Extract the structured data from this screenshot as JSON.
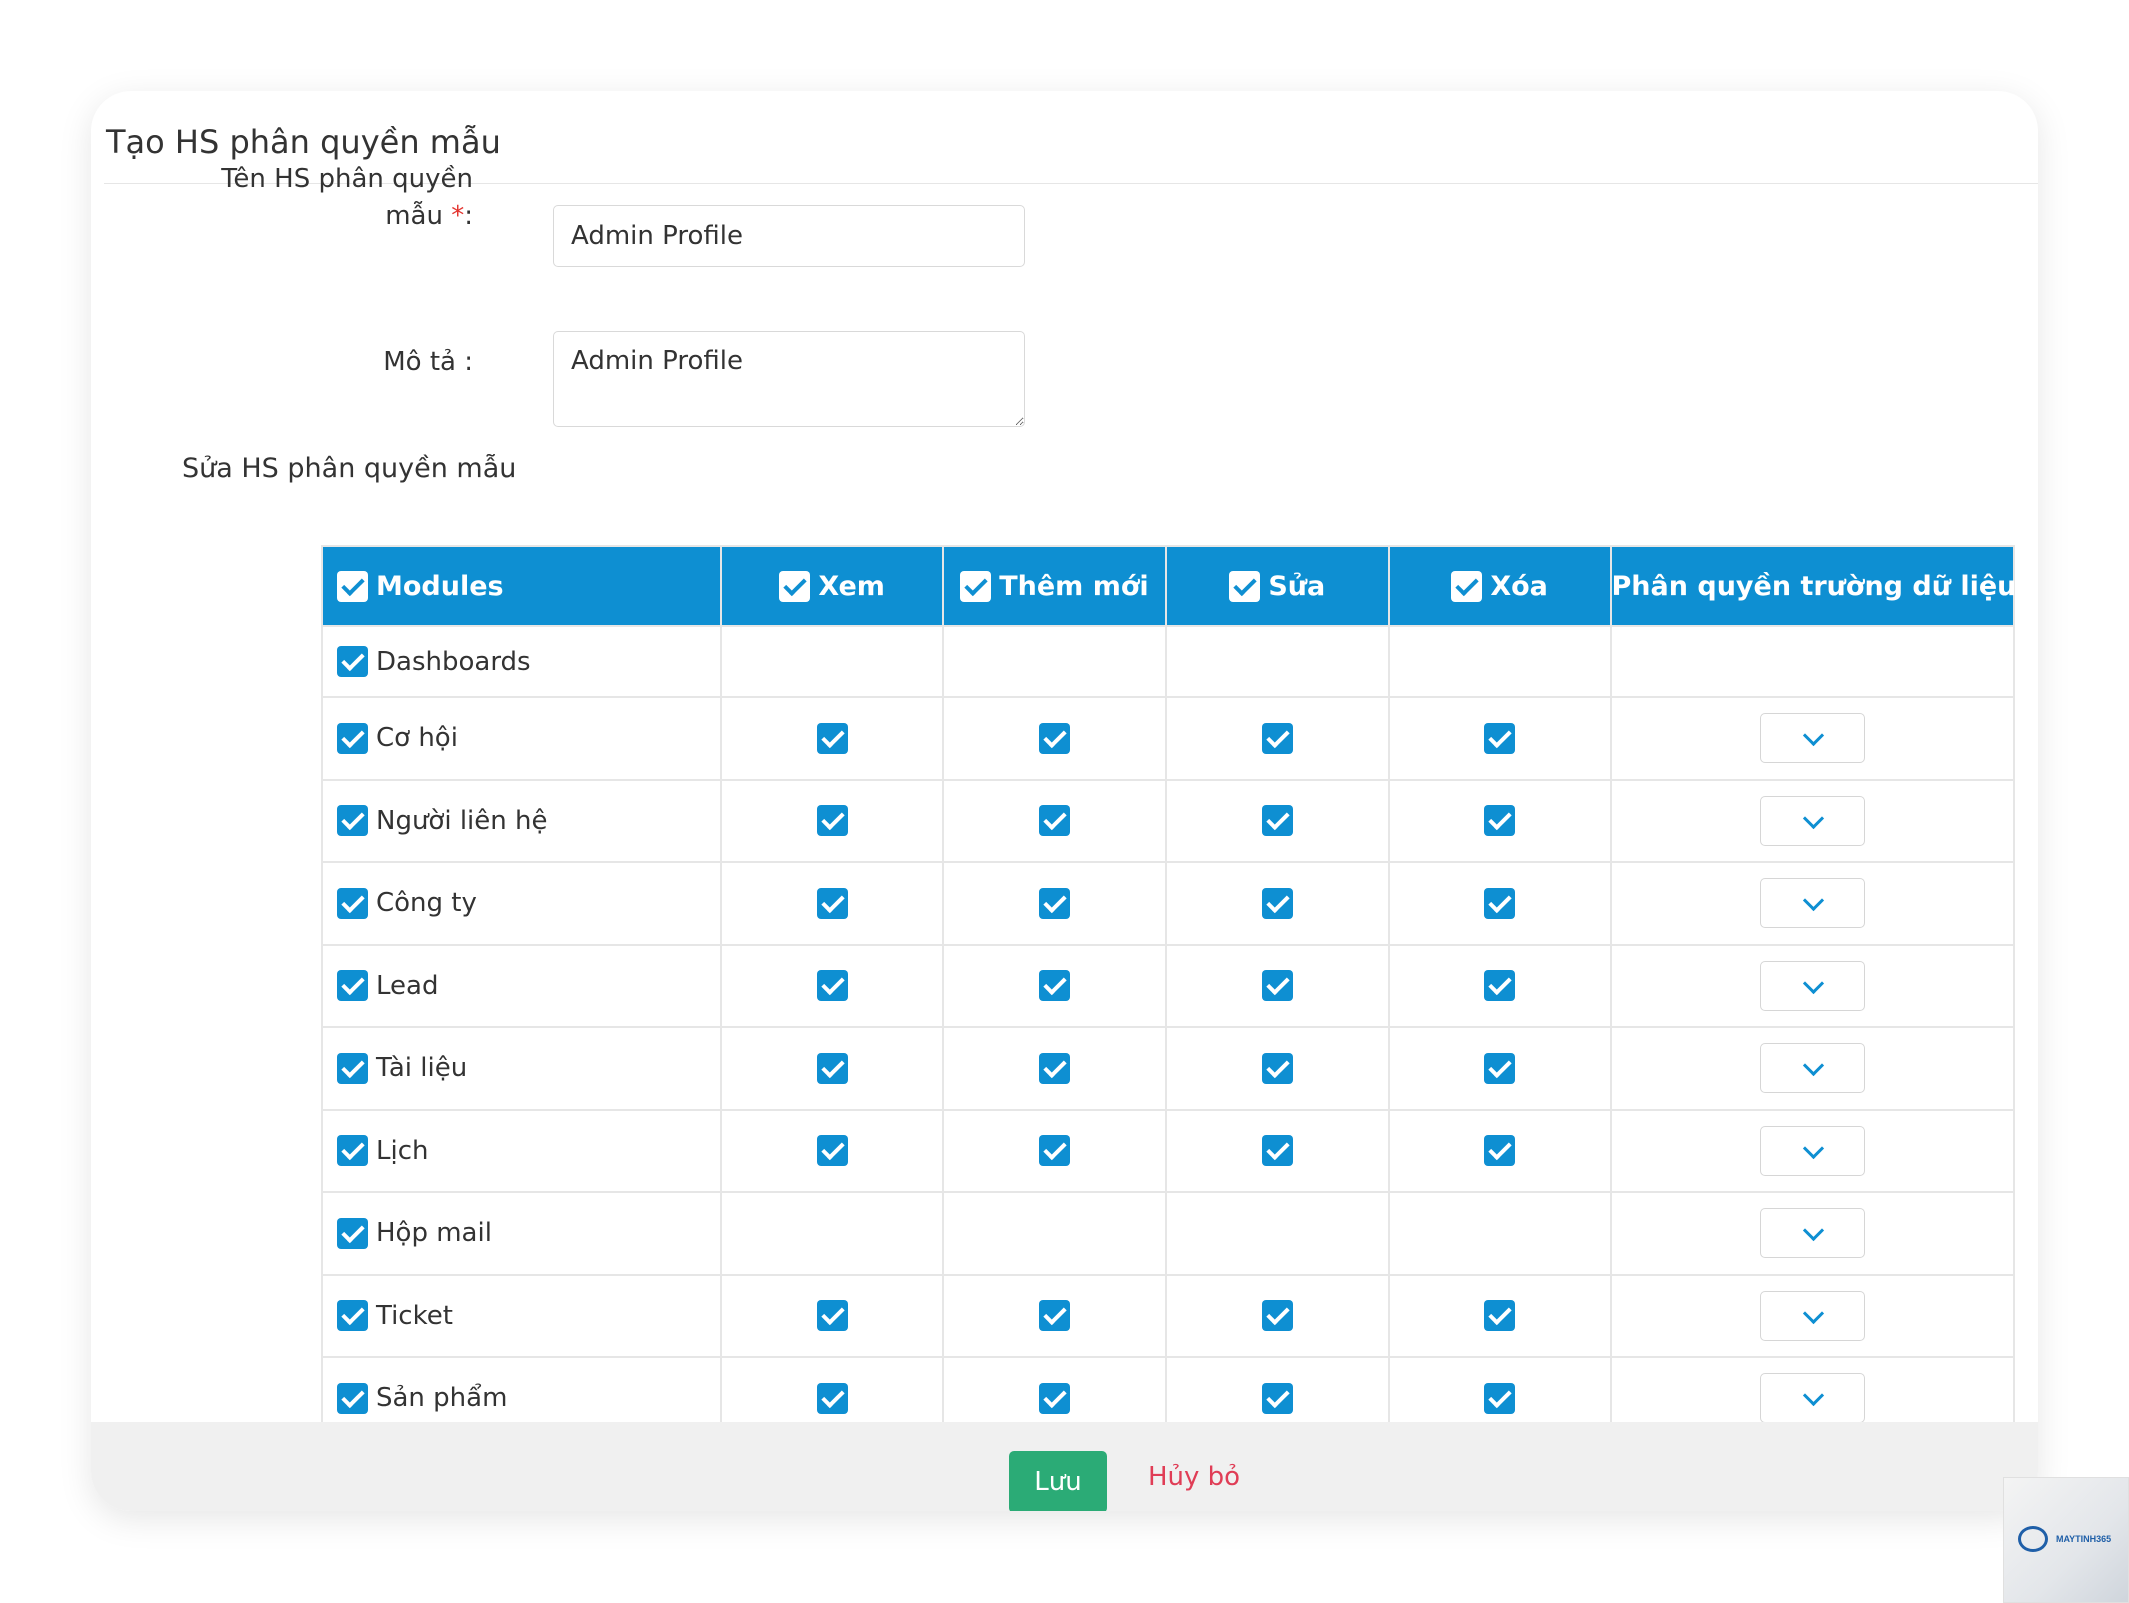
{
  "form": {
    "title": "Tạo HS phân quyền mẫu",
    "name_label_line1": "Tên HS phân quyền",
    "name_label_line2": "mẫu",
    "required_mark": "*",
    "name_label_colon": ":",
    "name_value": "Admin Profile",
    "desc_label": "Mô tả :",
    "desc_value": "Admin Profile",
    "section_title": "Sửa HS phân quyền mẫu"
  },
  "table": {
    "headers": {
      "modules": "Modules",
      "view": "Xem",
      "add": "Thêm mới",
      "edit": "Sửa",
      "delete": "Xóa",
      "field_permissions": "Phân quyền trường dữ liệu"
    },
    "rows": [
      {
        "name": "Dashboards",
        "perms": false,
        "dropdown": false
      },
      {
        "name": "Cơ hội",
        "perms": true,
        "dropdown": true
      },
      {
        "name": "Người liên hệ",
        "perms": true,
        "dropdown": true
      },
      {
        "name": "Công ty",
        "perms": true,
        "dropdown": true
      },
      {
        "name": "Lead",
        "perms": true,
        "dropdown": true
      },
      {
        "name": "Tài liệu",
        "perms": true,
        "dropdown": true
      },
      {
        "name": "Lịch",
        "perms": true,
        "dropdown": true
      },
      {
        "name": "Hộp mail",
        "perms": false,
        "dropdown": true
      },
      {
        "name": "Ticket",
        "perms": true,
        "dropdown": true
      },
      {
        "name": "Sản phẩm",
        "perms": true,
        "dropdown": true
      }
    ]
  },
  "footer": {
    "save_label": "Lưu",
    "cancel_label": "Hủy bỏ"
  },
  "watermark": {
    "text": "MAYTINH365"
  },
  "colors": {
    "accent": "#0e8fd2",
    "save": "#2bab76",
    "cancel": "#e03d56"
  },
  "icons": {
    "checkbox": "checkbox-checked-icon",
    "dropdown": "chevron-down-icon"
  }
}
